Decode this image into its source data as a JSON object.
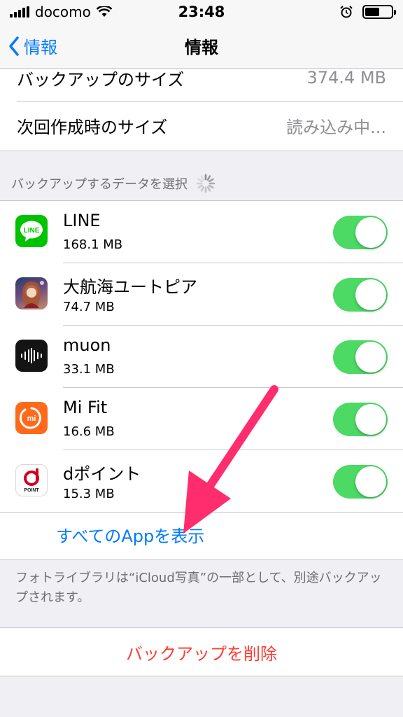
{
  "status_bar": {
    "carrier": "docomo",
    "time": "23:48"
  },
  "nav": {
    "back_label": "情報",
    "title": "情報"
  },
  "info": [
    {
      "label": "バックアップのサイズ",
      "value": "374.4 MB"
    },
    {
      "label": "次回作成時のサイズ",
      "value": "読み込み中..."
    }
  ],
  "section_header": "バックアップするデータを選択",
  "apps": [
    {
      "name": "LINE",
      "size": "168.1 MB",
      "icon": "line-app-icon",
      "enabled": true
    },
    {
      "name": "大航海ユートピア",
      "size": "74.7 MB",
      "icon": "utopia-app-icon",
      "enabled": true
    },
    {
      "name": "muon",
      "size": "33.1 MB",
      "icon": "muon-app-icon",
      "enabled": true
    },
    {
      "name": "Mi Fit",
      "size": "16.6 MB",
      "icon": "mifit-app-icon",
      "enabled": true
    },
    {
      "name": "dポイント",
      "size": "15.3 MB",
      "icon": "dpoint-app-icon",
      "enabled": true
    }
  ],
  "icon_text": {
    "line": "LINE",
    "mi": "mi",
    "dpoint": "POINT"
  },
  "show_all_label": "すべてのAppを表示",
  "footer_note": "フォトライブラリは“iCloud写真”の一部として、別途バックアップされます。",
  "delete_label": "バックアップを削除",
  "colors": {
    "accent": "#007aff",
    "toggle_on": "#4cd964",
    "destructive": "#ff3b30",
    "annotation_arrow": "#ff2d6e"
  }
}
